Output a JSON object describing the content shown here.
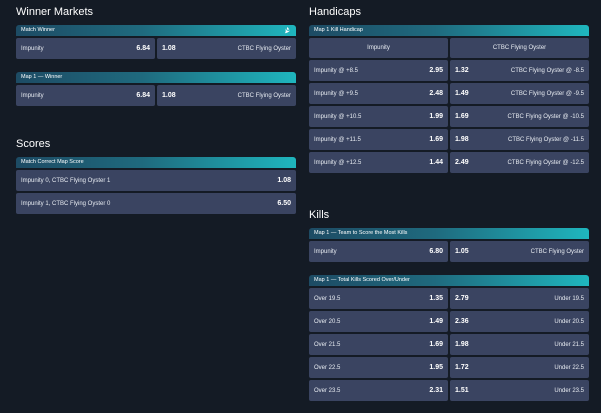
{
  "winner_markets": {
    "title": "Winner Markets",
    "match_winner": {
      "label": "Match Winner",
      "icon": "bird-icon",
      "home": {
        "team": "Impunity",
        "odds": "6.84"
      },
      "away": {
        "team": "CTBC Flying Oyster",
        "odds": "1.08"
      }
    },
    "map1_winner": {
      "label": "Map 1 — Winner",
      "home": {
        "team": "Impunity",
        "odds": "6.84"
      },
      "away": {
        "team": "CTBC Flying Oyster",
        "odds": "1.08"
      }
    }
  },
  "scores": {
    "title": "Scores",
    "market": {
      "label": "Match Correct Map Score",
      "rows": [
        {
          "label": "Impunity 0, CTBC Flying Oyster 1",
          "odds": "1.08"
        },
        {
          "label": "Impunity 1, CTBC Flying Oyster 0",
          "odds": "6.50"
        }
      ]
    }
  },
  "handicaps": {
    "title": "Handicaps",
    "market": {
      "label": "Map 1 Kill Handicap",
      "headers": [
        "Impunity",
        "CTBC Flying Oyster"
      ],
      "rows": [
        {
          "home": "Impunity @ +8.5",
          "home_odds": "2.95",
          "away_odds": "1.32",
          "away": "CTBC Flying Oyster @ -8.5"
        },
        {
          "home": "Impunity @ +9.5",
          "home_odds": "2.48",
          "away_odds": "1.49",
          "away": "CTBC Flying Oyster @ -9.5"
        },
        {
          "home": "Impunity @ +10.5",
          "home_odds": "1.99",
          "away_odds": "1.69",
          "away": "CTBC Flying Oyster @ -10.5"
        },
        {
          "home": "Impunity @ +11.5",
          "home_odds": "1.69",
          "away_odds": "1.98",
          "away": "CTBC Flying Oyster @ -11.5"
        },
        {
          "home": "Impunity @ +12.5",
          "home_odds": "1.44",
          "away_odds": "2.49",
          "away": "CTBC Flying Oyster @ -12.5"
        }
      ]
    }
  },
  "kills": {
    "title": "Kills",
    "most_kills": {
      "label": "Map 1 — Team to Score the Most Kills",
      "home": {
        "team": "Impunity",
        "odds": "6.80"
      },
      "away": {
        "team": "CTBC Flying Oyster",
        "odds": "1.05"
      }
    },
    "total_kills": {
      "label": "Map 1 — Total Kills Scored Over/Under",
      "rows": [
        {
          "over": "Over 19.5",
          "over_odds": "1.35",
          "under_odds": "2.79",
          "under": "Under 19.5"
        },
        {
          "over": "Over 20.5",
          "over_odds": "1.49",
          "under_odds": "2.36",
          "under": "Under 20.5"
        },
        {
          "over": "Over 21.5",
          "over_odds": "1.69",
          "under_odds": "1.98",
          "under": "Under 21.5"
        },
        {
          "over": "Over 22.5",
          "over_odds": "1.95",
          "under_odds": "1.72",
          "under": "Under 22.5"
        },
        {
          "over": "Over 23.5",
          "over_odds": "2.31",
          "under_odds": "1.51",
          "under": "Under 23.5"
        }
      ]
    }
  }
}
